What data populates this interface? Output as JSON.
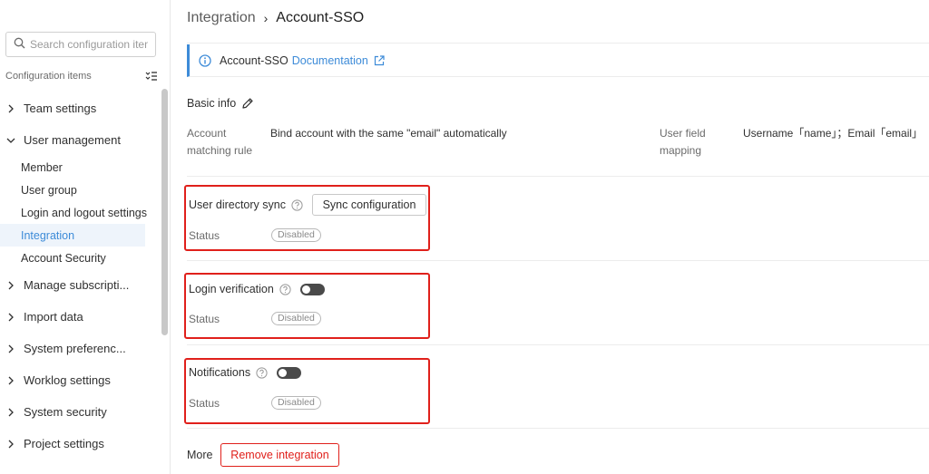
{
  "sidebar": {
    "search_placeholder": "Search configuration items",
    "config_header": "Configuration items",
    "groups": [
      {
        "label": "Team settings"
      },
      {
        "label": "User management"
      },
      {
        "label": "Manage subscripti..."
      },
      {
        "label": "Import data"
      },
      {
        "label": "System preferenc..."
      },
      {
        "label": "Worklog settings"
      },
      {
        "label": "System security"
      },
      {
        "label": "Project settings"
      }
    ],
    "user_management_items": [
      {
        "label": "Member"
      },
      {
        "label": "User group"
      },
      {
        "label": "Login and logout settings"
      },
      {
        "label": "Integration",
        "active": true
      },
      {
        "label": "Account Security"
      }
    ]
  },
  "breadcrumb": {
    "parent": "Integration",
    "separator": "›",
    "current": "Account-SSO"
  },
  "banner": {
    "text": "Account-SSO",
    "link": "Documentation"
  },
  "basic_info": {
    "title": "Basic info",
    "matching_rule_label_1": "Account",
    "matching_rule_label_2": "matching rule",
    "matching_rule_value": "Bind account with the same \"email\" automatically",
    "field_mapping_label_1": "User field",
    "field_mapping_label_2": "mapping",
    "field_mapping_value": "Username「name」；Email「email」"
  },
  "user_directory_sync": {
    "title": "User directory sync",
    "button": "Sync configuration",
    "status_label": "Status",
    "status": "Disabled"
  },
  "login_verification": {
    "title": "Login verification",
    "enabled": false,
    "status_label": "Status",
    "status": "Disabled"
  },
  "notifications": {
    "title": "Notifications",
    "enabled": false,
    "status_label": "Status",
    "status": "Disabled"
  },
  "more": {
    "label": "More",
    "remove_button": "Remove integration"
  },
  "colors": {
    "accent": "#3d8bd8",
    "danger": "#e0201b",
    "toggle_off": "#4a4a4a"
  }
}
